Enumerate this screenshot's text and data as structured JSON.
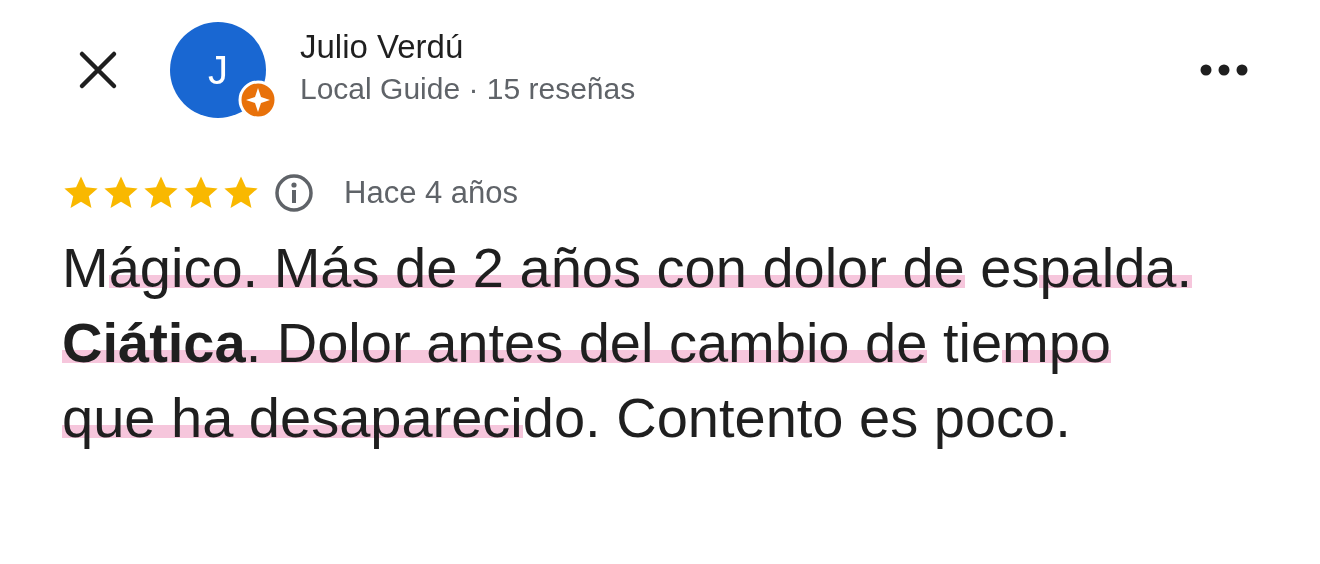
{
  "reviewer": {
    "initial": "J",
    "name": "Julio Verdú",
    "subtitle": "Local Guide · 15 reseñas",
    "local_guide": true
  },
  "rating": {
    "stars": 5,
    "time": "Hace 4 años"
  },
  "review": {
    "segments": [
      {
        "text": "M",
        "highlighted": false
      },
      {
        "text": "ágico. Más de 2 años con dolor de",
        "highlighted": true
      },
      {
        "text": " es",
        "highlighted": false
      },
      {
        "text": "palda. **Ciática**. Dolor antes del cambio de",
        "highlighted": true
      },
      {
        "text": " tie",
        "highlighted": false
      },
      {
        "text": "mpo que ha desapareci",
        "highlighted": true
      },
      {
        "text": "do. Contento es poco.",
        "highlighted": false
      }
    ]
  }
}
